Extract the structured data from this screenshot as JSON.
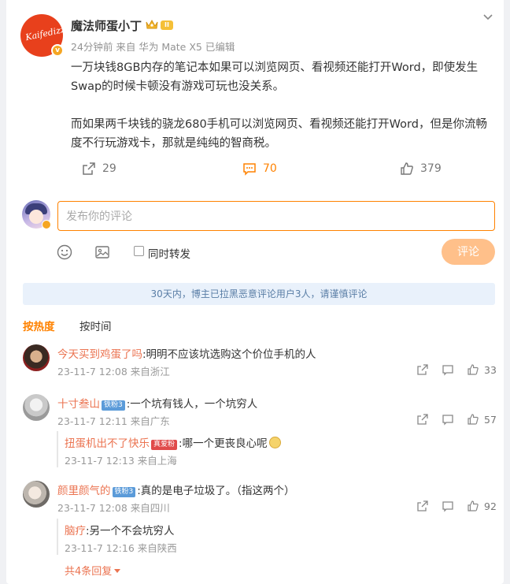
{
  "post": {
    "author": "魔法师蛋小丁",
    "avatar_signature": "Kaifedizz",
    "level_badge": "II",
    "meta": "24分钟前  来自 华为 Mate X5  已编辑",
    "paragraph1": "一万块钱8GB内存的笔记本如果可以浏览网页、看视频还能打开Word，即使发生Swap的时候卡顿没有游戏可玩也没关系。",
    "paragraph2": "而如果两千块钱的骁龙680手机可以浏览网页、看视频还能打开Word，但是你流畅度不行玩游戏卡，那就是纯纯的智商税。",
    "repost_count": "29",
    "comment_count": "70",
    "like_count": "379"
  },
  "composer": {
    "placeholder": "发布你的评论",
    "repost_label": "同时转发",
    "submit_label": "评论"
  },
  "notice": "30天内，博主已拉黑恶意评论用户3人，请谨慎评论",
  "tabs": {
    "hot": "按热度",
    "time": "按时间"
  },
  "comments": [
    {
      "user": "今天买到鸡蛋了吗",
      "text": ":明明不应该坑选购这个价位手机的人",
      "meta": "23-11-7 12:08 来自浙江",
      "likes": "33"
    },
    {
      "user": "十寸叁山",
      "badge": "铁粉3",
      "text": ":一个坑有钱人，一个坑穷人",
      "meta": "23-11-7 12:11 来自广东",
      "likes": "57",
      "reply": {
        "user": "扭蛋机出不了快乐",
        "badge": "真爱粉",
        "text": ":哪一个更丧良心呢",
        "meta": "23-11-7 12:13 来自上海"
      }
    },
    {
      "user": "颜里颜气的",
      "badge": "铁粉3",
      "text": ":真的是电子垃圾了。（指这两个）",
      "meta": "23-11-7 12:08 来自四川",
      "likes": "92",
      "reply": {
        "user": "脑疗",
        "text": ":另一个不会坑穷人",
        "meta": "23-11-7 12:16 来自陕西"
      },
      "more_replies": "共4条回复"
    }
  ],
  "colors": {
    "accent": "#ff8200",
    "username": "#eb7350",
    "notice_bg": "#e9f1fb"
  }
}
